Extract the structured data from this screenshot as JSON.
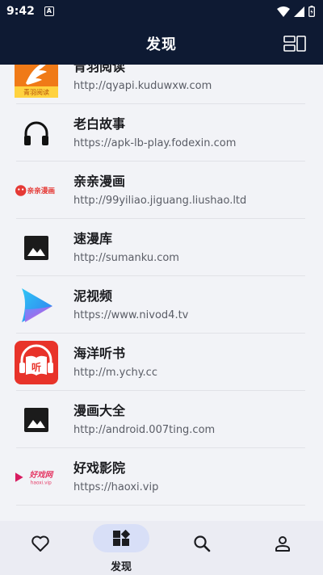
{
  "status": {
    "time": "9:42",
    "notification_glyph": "A"
  },
  "appbar": {
    "title": "发现"
  },
  "list": [
    {
      "name": "青羽阅读",
      "url": "http://qyapi.kuduwxw.com",
      "icon": "qingyu-logo",
      "logo_text": "青羽阅读"
    },
    {
      "name": "老白故事",
      "url": "https://apk-lb-play.fodexin.com",
      "icon": "headphones-icon"
    },
    {
      "name": "亲亲漫画",
      "url": "http://99yiliao.jiguang.liushao.ltd",
      "icon": "qinqin-logo",
      "logo_text": "亲亲漫画"
    },
    {
      "name": "速漫库",
      "url": "http://sumanku.com",
      "icon": "image-placeholder-icon"
    },
    {
      "name": "泥视频",
      "url": "https://www.nivod4.tv",
      "icon": "play-logo"
    },
    {
      "name": "海洋听书",
      "url": "http://m.ychy.cc",
      "icon": "book-listen-logo",
      "logo_text": "听"
    },
    {
      "name": "漫画大全",
      "url": "http://android.007ting.com",
      "icon": "image-placeholder-icon"
    },
    {
      "name": "好戏影院",
      "url": "https://haoxi.vip",
      "icon": "haoxi-logo",
      "logo_text": "好戏网",
      "logo_subtext": "haoxi.vip"
    }
  ],
  "nav": [
    {
      "id": "favorites",
      "icon": "heart-icon",
      "label": ""
    },
    {
      "id": "discover",
      "icon": "discover-grid-icon",
      "label": "发现",
      "active": true
    },
    {
      "id": "search",
      "icon": "search-icon",
      "label": ""
    },
    {
      "id": "profile",
      "icon": "person-icon",
      "label": ""
    }
  ],
  "colors": {
    "header_bg": "#0e1a33",
    "nav_bg": "#ebecf3",
    "active_pill": "#d8dff7",
    "list_bg": "#f2f3f7"
  }
}
